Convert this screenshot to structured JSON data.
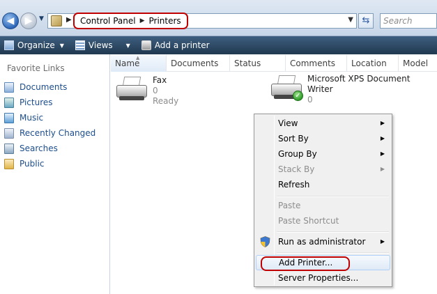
{
  "address_bar": {
    "crumbs": [
      "Control Panel",
      "Printers"
    ],
    "search_placeholder": "Search"
  },
  "toolbar": {
    "organize": "Organize",
    "views": "Views",
    "add_printer": "Add a printer"
  },
  "favorites": {
    "title": "Favorite Links",
    "items": [
      {
        "label": "Documents",
        "icon": "documents-icon"
      },
      {
        "label": "Pictures",
        "icon": "pictures-icon"
      },
      {
        "label": "Music",
        "icon": "music-icon"
      },
      {
        "label": "Recently Changed",
        "icon": "recently-changed-icon"
      },
      {
        "label": "Searches",
        "icon": "searches-icon"
      },
      {
        "label": "Public",
        "icon": "public-folder-icon"
      }
    ]
  },
  "columns": [
    "Name",
    "Documents",
    "Status",
    "Comments",
    "Location",
    "Model"
  ],
  "printers": [
    {
      "name": "Fax",
      "documents": "0",
      "status": "Ready",
      "default": false
    },
    {
      "name": "Microsoft XPS Document Writer",
      "documents": "0",
      "status": "",
      "default": true
    }
  ],
  "context_menu": {
    "items": [
      {
        "label": "View",
        "submenu": true,
        "disabled": false
      },
      {
        "label": "Sort By",
        "submenu": true,
        "disabled": false
      },
      {
        "label": "Group By",
        "submenu": true,
        "disabled": false
      },
      {
        "label": "Stack By",
        "submenu": true,
        "disabled": true
      },
      {
        "label": "Refresh",
        "submenu": false,
        "disabled": false
      },
      {
        "label": "Paste",
        "submenu": false,
        "disabled": true
      },
      {
        "label": "Paste Shortcut",
        "submenu": false,
        "disabled": true
      },
      {
        "label": "Run as administrator",
        "submenu": true,
        "disabled": false
      },
      {
        "label": "Add Printer...",
        "submenu": false,
        "disabled": false,
        "highlighted": true
      },
      {
        "label": "Server Properties...",
        "submenu": false,
        "disabled": false
      }
    ]
  },
  "colors": {
    "annotation_red": "#c00000",
    "toolbar_dark": "#20384f",
    "link_blue": "#1c4d8c"
  }
}
